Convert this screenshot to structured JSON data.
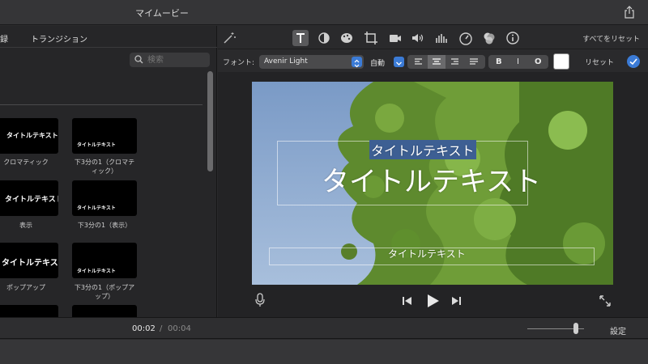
{
  "window": {
    "title": "マイムービー"
  },
  "browser": {
    "tabs": [
      "録",
      "トランジション"
    ],
    "search_placeholder": "検索",
    "items": [
      {
        "thumb_text": "タイトルテキスト",
        "label": "クロマティック"
      },
      {
        "thumb_text": "タイトルテキスト",
        "label": "下3分の1（クロマティック）"
      },
      {
        "thumb_text": "タイトルテキスト",
        "label": "表示"
      },
      {
        "thumb_text": "タイトルテキスト",
        "label": "下3分の1（表示）"
      },
      {
        "thumb_text": "タイトルテキス",
        "label": "ポップアップ"
      },
      {
        "thumb_text": "タイトルテキスト",
        "label": "下3分の1（ポップアップ）"
      }
    ]
  },
  "adjust_toolbar": {
    "tools": [
      "magic-wand-icon",
      "title-text-icon",
      "color-balance-icon",
      "color-correction-icon",
      "crop-icon",
      "stabilization-icon",
      "volume-icon",
      "equalizer-icon",
      "speed-icon",
      "filter-icon",
      "info-icon"
    ],
    "reset_all": "すべてをリセット"
  },
  "font_bar": {
    "font_label": "フォント:",
    "font_value": "Avenir Light",
    "size_value": "自動",
    "bold": "B",
    "italic": "I",
    "outline": "O",
    "text_color": "#ffffff",
    "reset": "リセット",
    "accent": "#3b7bd6"
  },
  "viewer": {
    "title_small": "タイトルテキスト",
    "title_large": "タイトルテキスト",
    "title_lower": "タイトルテキスト"
  },
  "timebar": {
    "current": "00:02",
    "separator": "/",
    "total": "00:04",
    "settings": "設定"
  }
}
